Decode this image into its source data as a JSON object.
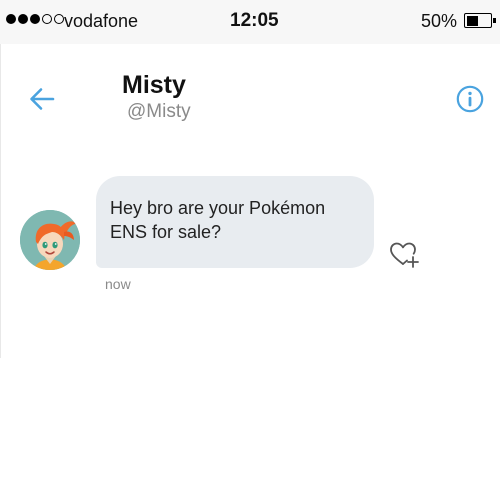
{
  "status_bar": {
    "signal_bars": 5,
    "signal_filled": 3,
    "carrier": "vodafone",
    "time": "12:05",
    "battery_percent": "50%",
    "battery_level": 0.5
  },
  "header": {
    "back_icon": "arrow-left-icon",
    "contact_name": "Misty",
    "contact_handle": "@Misty",
    "info_icon": "info-circle-icon"
  },
  "messages": [
    {
      "text": "Hey bro are your Pokémon ENS for sale?",
      "timestamp": "now",
      "avatar": "contact-avatar",
      "reaction_icon": "heart-add-icon"
    }
  ],
  "colors": {
    "accent": "#4aa3df",
    "bubble": "#e8ecf0",
    "muted_text": "#8a8a8a",
    "status_bar_bg": "#f7f7f7"
  }
}
